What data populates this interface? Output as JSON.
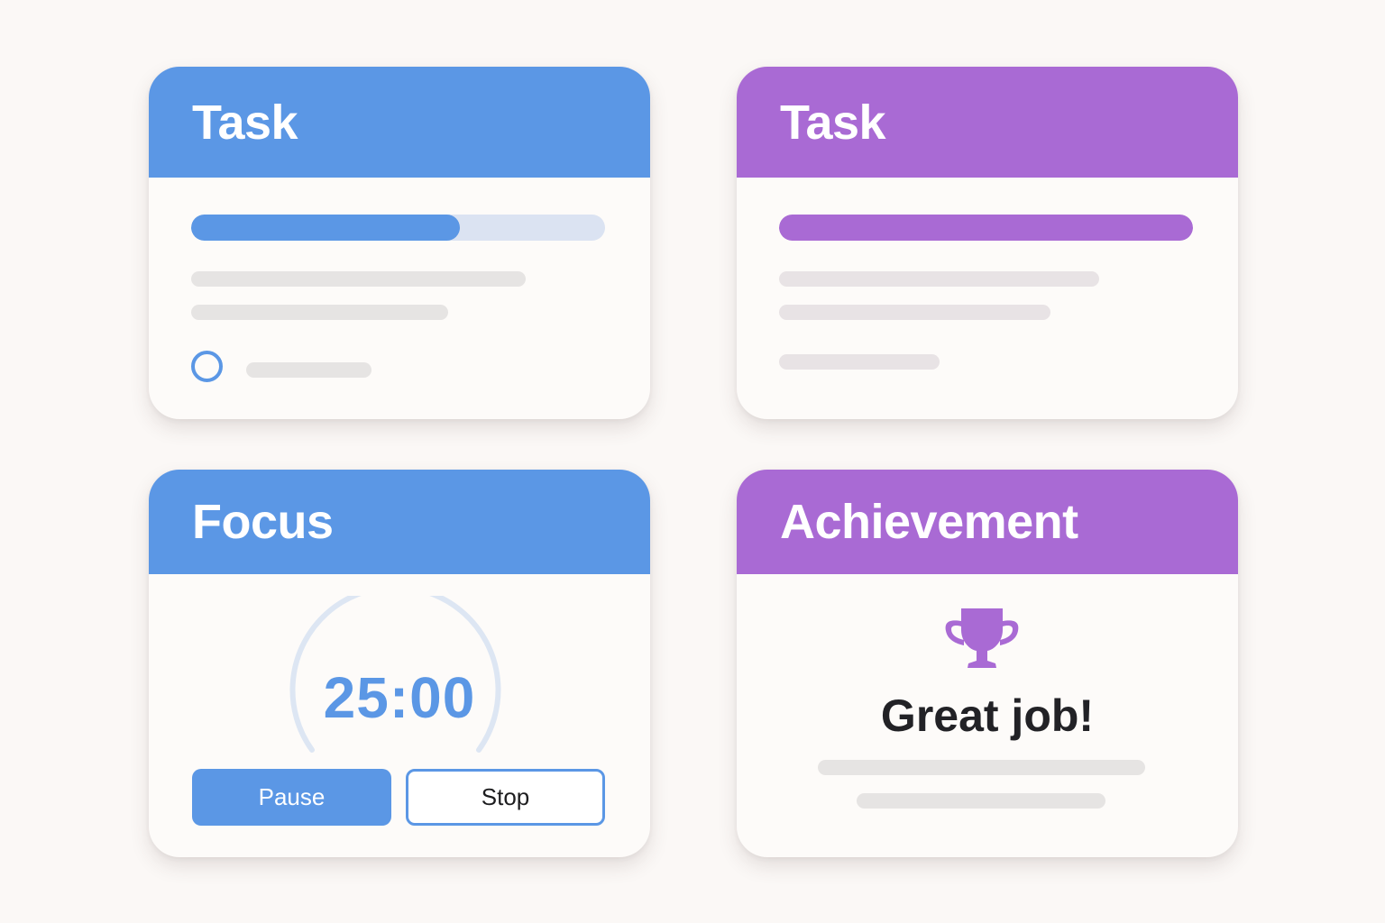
{
  "theme": {
    "blue": "#5b97e5",
    "purple": "#a96ad4",
    "blue_track": "#dbe3f2",
    "purple_track": "#a96ad4",
    "timer_ring": "#dde6f3",
    "stop_border": "#5b97e5"
  },
  "cards": {
    "task_blue": {
      "title": "Task",
      "progress": 0.65,
      "icon": "circle-checkbox-icon"
    },
    "task_purple": {
      "title": "Task",
      "progress": 1.0
    },
    "focus": {
      "title": "Focus",
      "timer": "25:00",
      "pause_label": "Pause",
      "stop_label": "Stop"
    },
    "achievement": {
      "title": "Achievement",
      "icon": "trophy-icon",
      "message": "Great job!"
    }
  }
}
